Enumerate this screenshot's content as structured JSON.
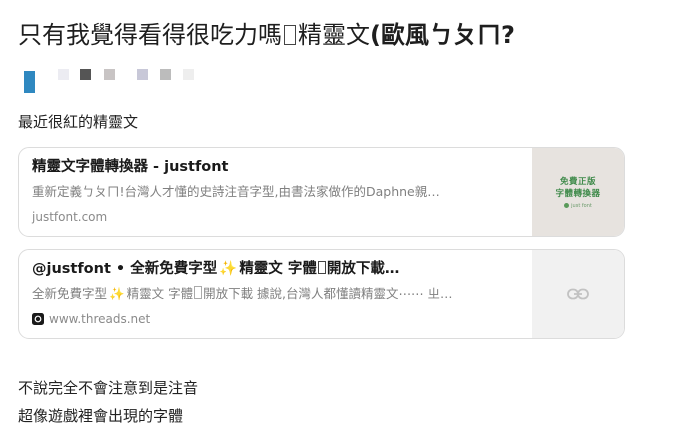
{
  "post": {
    "title_part1": "只有我覺得看得很吃力嗎",
    "title_part2": "精靈文",
    "title_part3": "(歐風ㄅㄆㄇ",
    "title_part4": "?"
  },
  "pixel_marks": [
    {
      "color": "#2f88c0",
      "tall": true
    },
    {
      "color": "#ececf2",
      "tall": false
    },
    {
      "color": "#555555",
      "tall": false
    },
    {
      "color": "#c8c4c4",
      "tall": false
    },
    {
      "color": "#c8c8d8",
      "tall": false
    },
    {
      "color": "#bcbcbc",
      "tall": false
    },
    {
      "color": "#eeeeee",
      "tall": false
    }
  ],
  "section": {
    "label": "最近很紅的精靈文"
  },
  "cards": [
    {
      "title": "精靈文字體轉換器 - justfont",
      "description": "重新定義ㄅㄆㄇ!台灣人才懂的史詩注音字型,由書法家做作的Daphne親…",
      "domain": "justfont.com",
      "thumb_line1": "免費正版",
      "thumb_line2": "字體轉換器",
      "thumb_logo": "just font"
    },
    {
      "title_part1": "@justfont • 全新免費字型",
      "title_part2": "精靈文 字體",
      "title_part3": "開放下載…",
      "desc_part1": "全新免費字型",
      "desc_part2": "精靈文 字體",
      "desc_part3": "開放下載 據說,台灣人都懂讀精靈文⋯⋯ ㄓ…",
      "domain": "www.threads.net"
    }
  ],
  "body": {
    "line1": "不說完全不會注意到是注音",
    "line2": "超像遊戲裡會出現的字體"
  },
  "colors": {
    "card_border": "#dcdcdc",
    "muted_text": "#808080",
    "thumb_green": "#3f8a4a",
    "accent_blue": "#2f88c0"
  },
  "icons": {
    "emoji": "sparkle-emoji",
    "threads": "threads-icon",
    "link": "link-icon"
  }
}
